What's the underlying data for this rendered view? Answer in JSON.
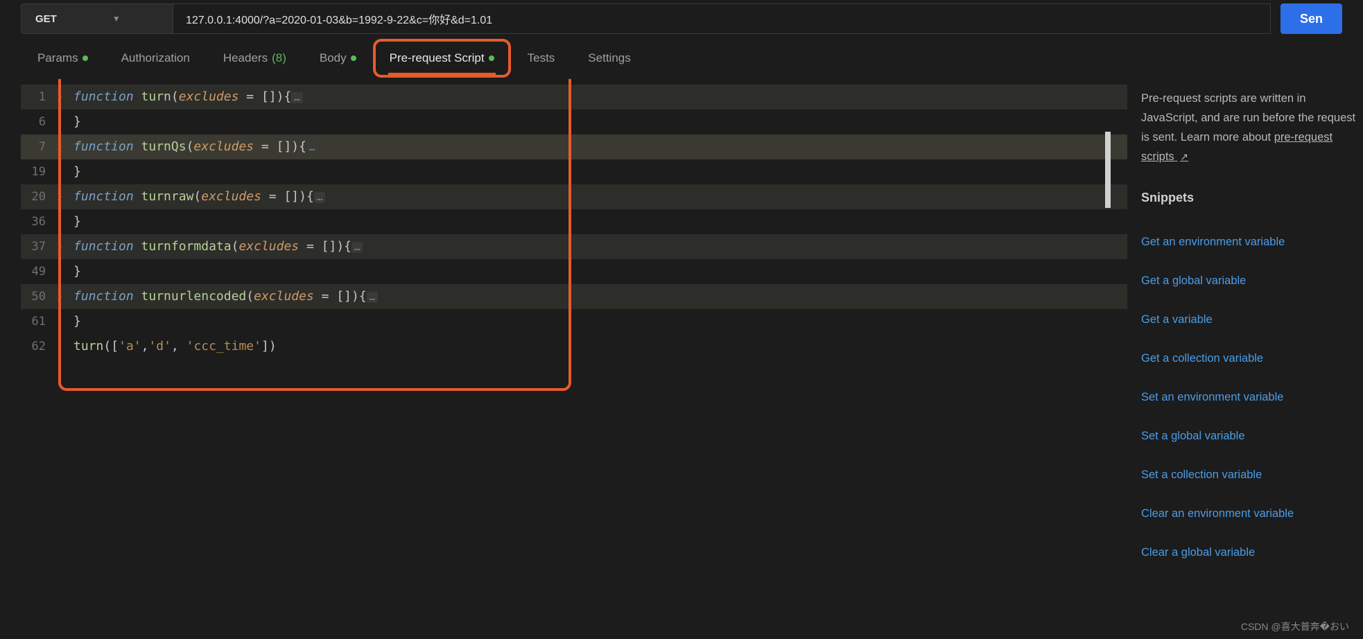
{
  "request": {
    "method": "GET",
    "url": "127.0.0.1:4000/?a=2020-01-03&b=1992-9-22&c=你好&d=1.01",
    "send_label": "Sen"
  },
  "tabs": {
    "params": "Params",
    "authorization": "Authorization",
    "headers": "Headers",
    "headers_count": "(8)",
    "body": "Body",
    "prerequest": "Pre-request Script",
    "tests": "Tests",
    "settings": "Settings"
  },
  "code": {
    "lines": [
      {
        "num": "1",
        "fold": true,
        "hl": "highlight",
        "tokens": [
          {
            "t": "kw",
            "v": "function"
          },
          {
            "t": "p",
            "v": " "
          },
          {
            "t": "fn",
            "v": "turn"
          },
          {
            "t": "punct",
            "v": "("
          },
          {
            "t": "param",
            "v": "excludes"
          },
          {
            "t": "punct",
            "v": " = []){"
          },
          {
            "t": "ell",
            "v": "…"
          }
        ]
      },
      {
        "num": "6",
        "fold": false,
        "hl": "",
        "tokens": [
          {
            "t": "punct",
            "v": "}"
          }
        ]
      },
      {
        "num": "7",
        "fold": true,
        "hl": "highlight2",
        "tokens": [
          {
            "t": "kw",
            "v": "function"
          },
          {
            "t": "p",
            "v": " "
          },
          {
            "t": "fn",
            "v": "turnQs"
          },
          {
            "t": "punct",
            "v": "("
          },
          {
            "t": "param",
            "v": "excludes"
          },
          {
            "t": "punct",
            "v": " = []){"
          },
          {
            "t": "ell",
            "v": "…"
          }
        ]
      },
      {
        "num": "19",
        "fold": false,
        "hl": "",
        "tokens": [
          {
            "t": "punct",
            "v": "}"
          }
        ]
      },
      {
        "num": "20",
        "fold": true,
        "hl": "highlight",
        "tokens": [
          {
            "t": "kw",
            "v": "function"
          },
          {
            "t": "p",
            "v": " "
          },
          {
            "t": "fn",
            "v": "turnraw"
          },
          {
            "t": "punct",
            "v": "("
          },
          {
            "t": "param",
            "v": "excludes"
          },
          {
            "t": "punct",
            "v": " = []){"
          },
          {
            "t": "ell",
            "v": "…"
          }
        ]
      },
      {
        "num": "36",
        "fold": false,
        "hl": "",
        "tokens": [
          {
            "t": "punct",
            "v": "}"
          }
        ]
      },
      {
        "num": "37",
        "fold": true,
        "hl": "highlight",
        "tokens": [
          {
            "t": "kw",
            "v": "function"
          },
          {
            "t": "p",
            "v": " "
          },
          {
            "t": "fn",
            "v": "turnformdata"
          },
          {
            "t": "punct",
            "v": "("
          },
          {
            "t": "param",
            "v": "excludes"
          },
          {
            "t": "punct",
            "v": " = []){"
          },
          {
            "t": "ell",
            "v": "…"
          }
        ]
      },
      {
        "num": "49",
        "fold": false,
        "hl": "",
        "tokens": [
          {
            "t": "punct",
            "v": "}"
          }
        ]
      },
      {
        "num": "50",
        "fold": true,
        "hl": "highlight",
        "tokens": [
          {
            "t": "kw",
            "v": "function"
          },
          {
            "t": "p",
            "v": " "
          },
          {
            "t": "fn",
            "v": "turnurlencoded"
          },
          {
            "t": "punct",
            "v": "("
          },
          {
            "t": "param",
            "v": "excludes"
          },
          {
            "t": "punct",
            "v": " = []){"
          },
          {
            "t": "ell",
            "v": "…"
          }
        ]
      },
      {
        "num": "61",
        "fold": false,
        "hl": "",
        "tokens": [
          {
            "t": "punct",
            "v": "}"
          }
        ]
      },
      {
        "num": "62",
        "fold": false,
        "hl": "",
        "tokens": [
          {
            "t": "fn",
            "v": "turn"
          },
          {
            "t": "punct",
            "v": "(["
          },
          {
            "t": "str",
            "v": "'a'"
          },
          {
            "t": "punct",
            "v": ","
          },
          {
            "t": "str",
            "v": "'d'"
          },
          {
            "t": "punct",
            "v": ", "
          },
          {
            "t": "str",
            "v": "'ccc_time'"
          },
          {
            "t": "punct",
            "v": "])"
          }
        ]
      }
    ]
  },
  "sidebar": {
    "description": "Pre-request scripts are written in JavaScript, and are run before the request is sent. Learn more about ",
    "link_text": "pre-request scripts",
    "snippets_title": "Snippets",
    "snippets": [
      "Get an environment variable",
      "Get a global variable",
      "Get a variable",
      "Get a collection variable",
      "Set an environment variable",
      "Set a global variable",
      "Set a collection variable",
      "Clear an environment variable",
      "Clear a global variable"
    ]
  },
  "watermark": "CSDN @喜大普奔�おい"
}
